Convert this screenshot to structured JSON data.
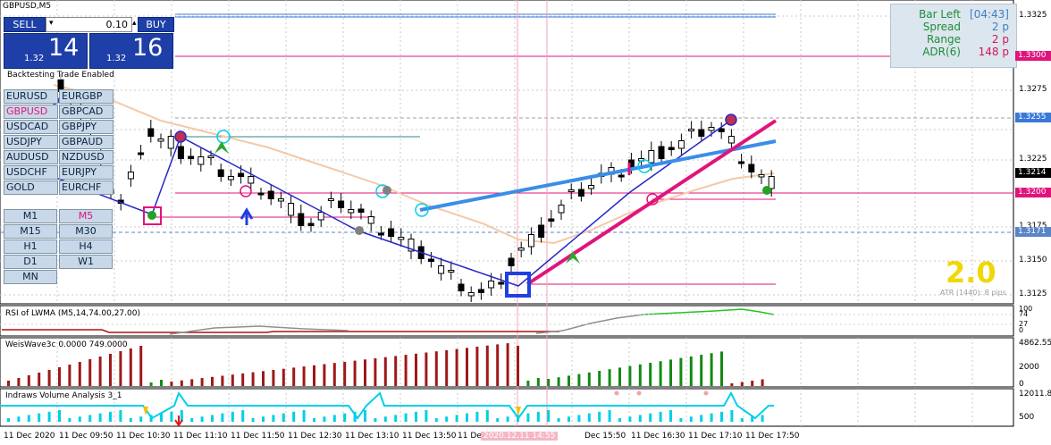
{
  "window_title": "GBPUSD,M5",
  "trade_panel": {
    "sell_label": "SELL",
    "buy_label": "BUY",
    "lot_value": "0.10",
    "sell_price_prefix": "1.32",
    "sell_price_big": "14",
    "buy_price_prefix": "1.32",
    "buy_price_big": "16",
    "backtesting_text": "Backtesting Trade Enabled"
  },
  "symbols": [
    [
      "EURUSD",
      "EURGBP"
    ],
    [
      "GBPUSD",
      "GBPCAD"
    ],
    [
      "USDCAD",
      "GBPJPY"
    ],
    [
      "USDJPY",
      "GBPAUD"
    ],
    [
      "AUDUSD",
      "NZDUSD"
    ],
    [
      "USDCHF",
      "EURJPY"
    ],
    [
      "GOLD",
      "EURCHF"
    ]
  ],
  "active_symbol": "GBPUSD",
  "timeframes": [
    [
      "M1",
      "M5"
    ],
    [
      "M15",
      "M30"
    ],
    [
      "H1",
      "H4"
    ],
    [
      "D1",
      "W1"
    ],
    [
      "MN",
      ""
    ]
  ],
  "active_timeframe": "M5",
  "info_box": {
    "bar_left_label": "Bar Left",
    "bar_left_value": "[04:43]",
    "spread_label": "Spread",
    "spread_value": "2 p",
    "range_label": "Range",
    "range_value": "2 p",
    "adr_label": "ADR(6)",
    "adr_value": "148 p"
  },
  "price_axis": {
    "ticks": [
      "1.3325",
      "1.3300",
      "1.3275",
      "1.3250",
      "1.3225",
      "1.3200",
      "1.3175",
      "1.3150",
      "1.3125"
    ],
    "tags": [
      {
        "text": "1.3300",
        "color": "#e0147c"
      },
      {
        "text": "1.3255",
        "color": "#3a78d8"
      },
      {
        "text": "1.3214",
        "color": "#000000"
      },
      {
        "text": "1.3200",
        "color": "#e0147c"
      },
      {
        "text": "1.3171",
        "color": "#5a84c8"
      }
    ]
  },
  "atr_big": "2.0",
  "atr_text": "ATR (1440): 8 pips",
  "rsi_panel": {
    "title": "RSI of LWMA (M5,14,74.00,27.00)",
    "ticks": [
      "100",
      "74",
      "27",
      "0"
    ]
  },
  "weis_panel": {
    "title": "WeisWave3c 0.0000 749.0000",
    "ticks": [
      "4862.55",
      "2000",
      "0"
    ]
  },
  "volume_panel": {
    "title": "Indraws Volume Analysis 3_1",
    "ticks": [
      "12011.8",
      "500"
    ]
  },
  "time_axis": [
    "11 Dec 2020",
    "11 Dec 09:50",
    "11 Dec 10:30",
    "11 Dec 11:10",
    "11 Dec 11:50",
    "11 Dec 12:30",
    "11 Dec 13:10",
    "11 Dec 13:50",
    "11 Dec",
    "2020.12.11 14:55",
    "Dec 15:50",
    "11 Dec 16:30",
    "11 Dec 17:10",
    "11 Dec 17:50"
  ],
  "colors": {
    "sell_button": "#1f3fa8",
    "magenta_level": "#e0147c",
    "blue_trend": "#2828c8",
    "light_blue_trend": "#3a8ee8",
    "pink_trend": "#e0147c",
    "weis_down": "#a01818",
    "weis_up": "#138a13",
    "rsi_line_up": "#22c322",
    "rsi_line_down": "#b01010",
    "volume_line": "#00cfe8"
  }
}
